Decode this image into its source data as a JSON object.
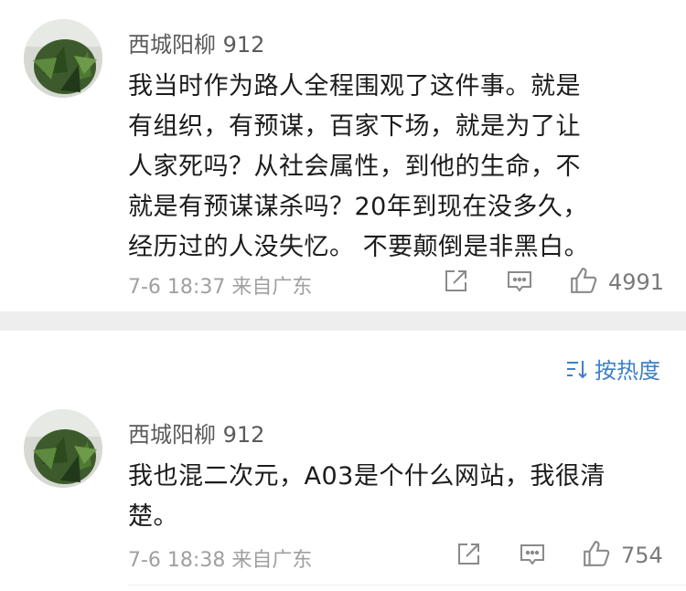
{
  "comments": [
    {
      "username": "西城阳柳 912",
      "lines": [
        "我当时作为路人全程围观了这件事。就是",
        "有组织，有预谋，百家下场，就是为了让",
        "人家死吗？从社会属性，到他的生命，不",
        "就是有预谋谋杀吗？20年到现在没多久，",
        "经历过的人没失忆。 不要颠倒是非黑白。"
      ],
      "timestamp": "7-6 18:37 来自广东",
      "likes": "4991"
    },
    {
      "username": "西城阳柳 912",
      "lines": [
        "我也混二次元，A03是个什么网站，我很清",
        "楚。"
      ],
      "timestamp": "7-6 18:38 来自广东",
      "likes": "754"
    }
  ],
  "sort": {
    "label": "按热度"
  },
  "icons": {
    "share": "share-icon",
    "comment": "comment-icon",
    "like": "thumbs-up-icon",
    "sort": "sort-icon"
  },
  "colors": {
    "accent": "#3f7fc7",
    "meta": "#a0a0a0",
    "separator": "#eeeeee"
  }
}
